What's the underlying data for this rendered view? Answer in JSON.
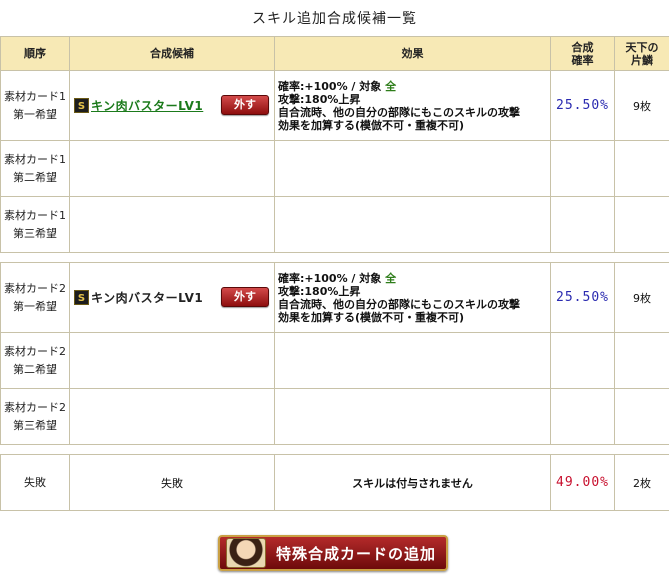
{
  "page_title": "スキル追加合成候補一覧",
  "headers": {
    "order": "順序",
    "candidate": "合成候補",
    "effect": "効果",
    "rate_line1": "合成",
    "rate_line2": "確率",
    "frag_line1": "天下の",
    "frag_line2": "片鱗"
  },
  "material1": {
    "rows": [
      {
        "order_line1": "素材カード1",
        "order_line2": "第一希望",
        "badge": "S",
        "skill": "キン肉バスターLV1",
        "remove_label": "外す",
        "effect_line1_prefix": "確率:+100% / 対象 ",
        "effect_target": "全",
        "effect_line2": "攻撃:180%上昇",
        "effect_line3": "自合流時、他の自分の部隊にもこのスキルの攻撃",
        "effect_line4": "効果を加算する(模倣不可・重複不可)",
        "rate": "25.50%",
        "fragments": "9枚"
      },
      {
        "order_line1": "素材カード1",
        "order_line2": "第二希望"
      },
      {
        "order_line1": "素材カード1",
        "order_line2": "第三希望"
      }
    ]
  },
  "material2": {
    "rows": [
      {
        "order_line1": "素材カード2",
        "order_line2": "第一希望",
        "badge": "S",
        "skill": "キン肉バスターLV1",
        "remove_label": "外す",
        "effect_line1_prefix": "確率:+100% / 対象 ",
        "effect_target": "全",
        "effect_line2": "攻撃:180%上昇",
        "effect_line3": "自合流時、他の自分の部隊にもこのスキルの攻撃",
        "effect_line4": "効果を加算する(模倣不可・重複不可)",
        "rate": "25.50%",
        "fragments": "9枚"
      },
      {
        "order_line1": "素材カード2",
        "order_line2": "第二希望"
      },
      {
        "order_line1": "素材カード2",
        "order_line2": "第三希望"
      }
    ]
  },
  "failure": {
    "order": "失敗",
    "candidate": "失敗",
    "effect": "スキルは付与されません",
    "rate": "49.00%",
    "fragments": "2枚"
  },
  "add_special_button": "特殊合成カードの追加",
  "colors": {
    "header_bg": "#f7e9b5",
    "rate_blue": "#2a2ab0",
    "rate_red": "#c8102e",
    "skill_green": "#1b7a1b",
    "button_red": "#8e0e0e"
  }
}
